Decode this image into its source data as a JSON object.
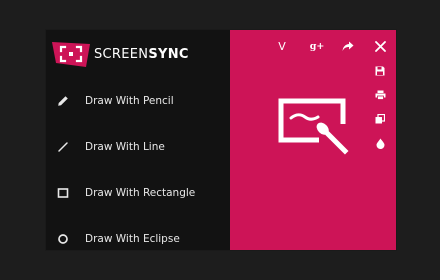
{
  "app": {
    "logo_light": "SCREEN",
    "logo_bold": "SYNC",
    "colors": {
      "accent": "#cd1457",
      "menu_bg": "#121212",
      "page_bg": "#1d1d1d",
      "text": "#e8e8e8"
    }
  },
  "menu": {
    "items": [
      {
        "label": "Draw With Pencil",
        "icon": "pencil-icon"
      },
      {
        "label": "Draw With Line",
        "icon": "line-icon"
      },
      {
        "label": "Draw With Rectangle",
        "icon": "rectangle-icon"
      },
      {
        "label": "Draw With Eclipse",
        "icon": "ellipse-icon"
      }
    ]
  },
  "toolbar": {
    "top": [
      {
        "icon": "vimeo-icon",
        "glyph": "V"
      },
      {
        "icon": "google-plus-icon",
        "glyph": "g+"
      },
      {
        "icon": "share-icon"
      },
      {
        "icon": "close-icon"
      }
    ],
    "side": [
      {
        "icon": "save-icon"
      },
      {
        "icon": "print-icon"
      },
      {
        "icon": "copy-icon"
      },
      {
        "icon": "color-drop-icon"
      }
    ]
  },
  "canvas": {
    "illustration": "draw-on-screen-icon"
  }
}
